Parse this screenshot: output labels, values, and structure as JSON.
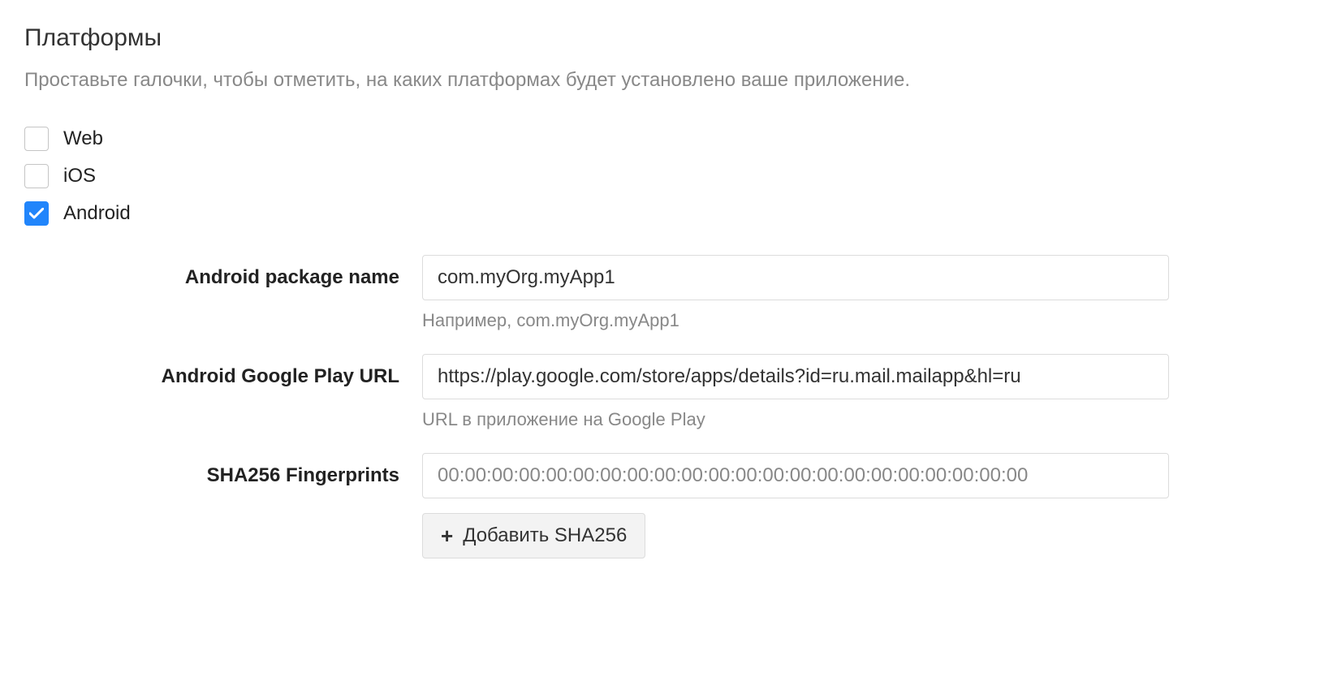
{
  "title": "Платформы",
  "description": "Проставьте галочки, чтобы отметить, на каких платформах будет установлено ваше приложение.",
  "platforms": {
    "web": {
      "label": "Web",
      "checked": false
    },
    "ios": {
      "label": "iOS",
      "checked": false
    },
    "android": {
      "label": "Android",
      "checked": true
    }
  },
  "fields": {
    "package": {
      "label": "Android package name",
      "value": "com.myOrg.myApp1",
      "hint": "Например, com.myOrg.myApp1"
    },
    "playurl": {
      "label": "Android Google Play URL",
      "value": "https://play.google.com/store/apps/details?id=ru.mail.mailapp&hl=ru",
      "hint": "URL в приложение на Google Play"
    },
    "sha256": {
      "label": "SHA256 Fingerprints",
      "placeholder": "00:00:00:00:00:00:00:00:00:00:00:00:00:00:00:00:00:00:00:00:00:00",
      "value": ""
    }
  },
  "addButton": "Добавить SHA256"
}
